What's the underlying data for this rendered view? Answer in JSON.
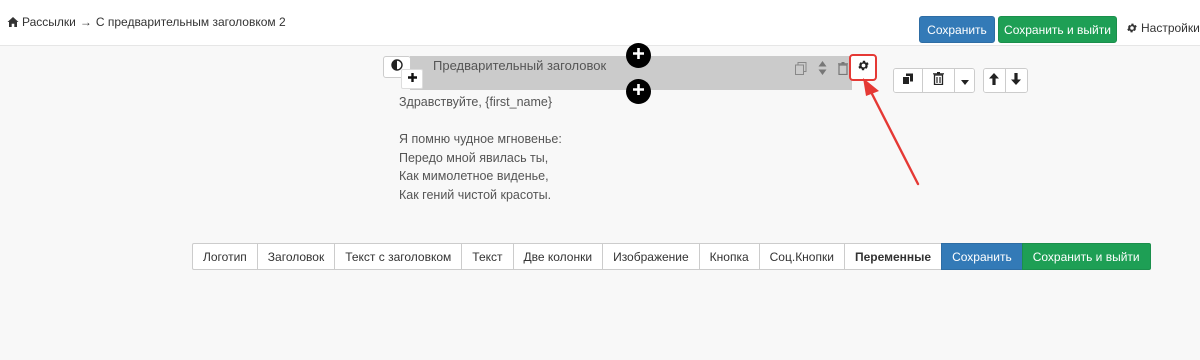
{
  "header": {
    "breadcrumb": {
      "home_icon": "home-icon",
      "section": "Рассылки",
      "separator": "→",
      "current": "С предварительным заголовком 2"
    },
    "buttons": {
      "save": "Сохранить",
      "save_exit": "Сохранить и выйти",
      "settings": "Настройки"
    }
  },
  "editor": {
    "preheader_label": "Предварительный заголовок",
    "body_lines": [
      "Здравствуйте, {first_name}",
      "",
      "Я помню чудное мгновенье:",
      "Передо мной явилась ты,",
      "Как мимолетное виденье,",
      "Как гений чистой красоты."
    ],
    "icons": {
      "contrast": "contrast-icon",
      "add": "plus-icon",
      "copy": "copy-icon",
      "sort": "sort-icon",
      "delete": "trash-icon",
      "settings": "gear-icon"
    },
    "highlight_color": "#e53935"
  },
  "blocks_toolbar": {
    "items": [
      "Логотип",
      "Заголовок",
      "Текст с заголовком",
      "Текст",
      "Две колонки",
      "Изображение",
      "Кнопка",
      "Соц.Кнопки",
      "Переменные"
    ],
    "save": "Сохранить",
    "save_exit": "Сохранить и выйти"
  },
  "colors": {
    "primary": "#337ab7",
    "success": "#1e9f55",
    "preheader_bg": "#cbcbcb"
  }
}
